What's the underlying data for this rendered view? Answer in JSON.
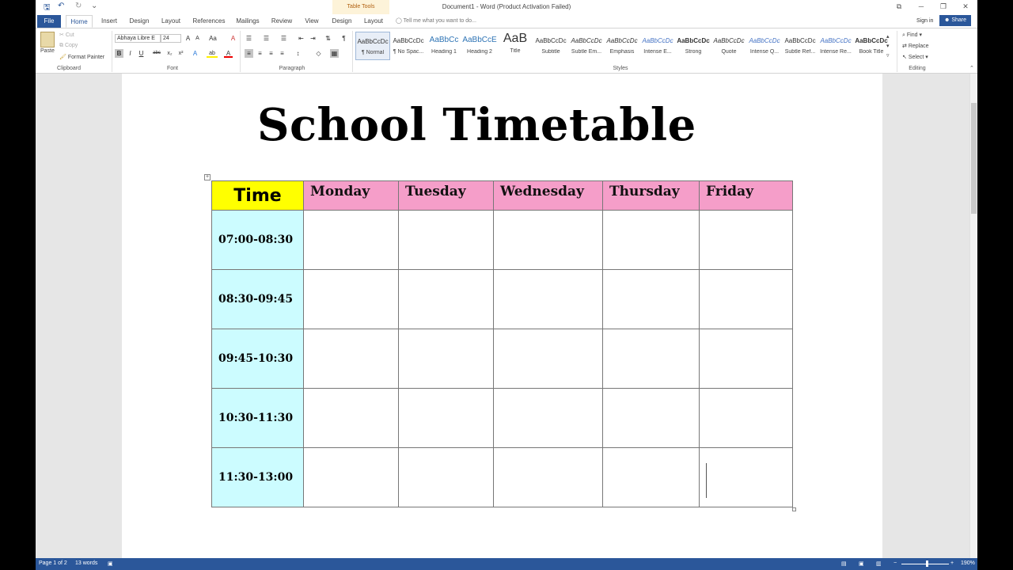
{
  "titlebar": {
    "doc_title": "Document1 - Word (Product Activation Failed)",
    "context_tab_group": "Table Tools",
    "qat_save": "🖫",
    "qat_undo": "↶",
    "qat_redo": "↻",
    "qat_customize": "⌄",
    "ribbon_options": "⧉",
    "minimize": "─",
    "restore": "❐",
    "close": "✕"
  },
  "tabs": {
    "file": "File",
    "items": [
      "Home",
      "Insert",
      "Design",
      "Layout",
      "References",
      "Mailings",
      "Review",
      "View"
    ],
    "context_items": [
      "Design",
      "Layout"
    ],
    "tell_me_placeholder": "Tell me what you want to do...",
    "sign_in": "Sign in",
    "share": "Share"
  },
  "ribbon": {
    "clipboard": {
      "label": "Clipboard",
      "paste": "Paste",
      "cut": "Cut",
      "copy": "Copy",
      "format_painter": "Format Painter"
    },
    "font": {
      "label": "Font",
      "font_name": "Abhaya Libre E",
      "font_size": "24",
      "grow": "A",
      "shrink": "A",
      "case": "Aa",
      "clear": "A",
      "bold": "B",
      "italic": "I",
      "underline": "U",
      "strike": "abc",
      "subscript": "x₂",
      "superscript": "x²",
      "text_effects": "A",
      "highlight": "ab",
      "font_color": "A"
    },
    "paragraph": {
      "label": "Paragraph",
      "show_marks": "¶",
      "bullets": "☰",
      "numbering": "☰",
      "multilevel": "☰",
      "decrease_indent": "⇤",
      "increase_indent": "⇥",
      "sort": "⇅",
      "align_left": "≡",
      "align_center": "≡",
      "align_right": "≡",
      "justify": "≡",
      "line_spacing": "↕",
      "shading": "◇",
      "borders": "▦"
    },
    "styles": {
      "label": "Styles",
      "items": [
        {
          "sample": "AaBbCcDc",
          "name": "¶ Normal"
        },
        {
          "sample": "AaBbCcDc",
          "name": "¶ No Spac..."
        },
        {
          "sample": "AaBbCc",
          "name": "Heading 1"
        },
        {
          "sample": "AaBbCcE",
          "name": "Heading 2"
        },
        {
          "sample": "AaB",
          "name": "Title"
        },
        {
          "sample": "AaBbCcDc",
          "name": "Subtitle"
        },
        {
          "sample": "AaBbCcDc",
          "name": "Subtle Em..."
        },
        {
          "sample": "AaBbCcDc",
          "name": "Emphasis"
        },
        {
          "sample": "AaBbCcDc",
          "name": "Intense E..."
        },
        {
          "sample": "AaBbCcDc",
          "name": "Strong"
        },
        {
          "sample": "AaBbCcDc",
          "name": "Quote"
        },
        {
          "sample": "AaBbCcDc",
          "name": "Intense Q..."
        },
        {
          "sample": "AaBbCcDc",
          "name": "Subtle Ref..."
        },
        {
          "sample": "AaBbCcDc",
          "name": "Intense Re..."
        },
        {
          "sample": "AaBbCcDc",
          "name": "Book Title"
        }
      ]
    },
    "editing": {
      "label": "Editing",
      "find": "Find",
      "replace": "Replace",
      "select": "Select"
    }
  },
  "document": {
    "heading": "School Timetable",
    "table": {
      "time_header": "Time",
      "days": [
        "Monday",
        "Tuesday",
        "Wednesday",
        "Thursday",
        "Friday"
      ],
      "time_slots": [
        "07:00-08:30",
        "08:30-09:45",
        "09:45-10:30",
        "10:30-11:30",
        "11:30-13:00"
      ]
    }
  },
  "statusbar": {
    "page": "Page 1 of 2",
    "words": "13 words",
    "zoom": "190%"
  },
  "colors": {
    "accent": "#2b579a",
    "time_header_bg": "#ffff00",
    "day_header_bg": "#f59ec9",
    "time_cell_bg": "#ccfcff"
  }
}
